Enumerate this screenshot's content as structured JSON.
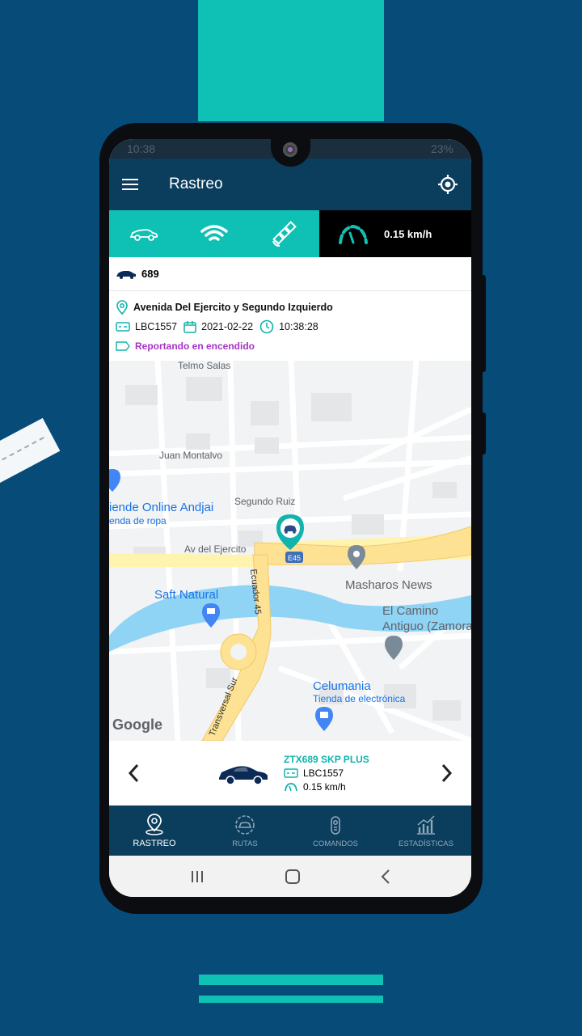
{
  "status_bar": {
    "time": "10:38",
    "battery": "23%"
  },
  "app_bar": {
    "title": "Rastreo",
    "menu_icon": "menu-icon",
    "locate_icon": "gps-target-icon"
  },
  "status_icons": [
    "car-icon",
    "signal-icon",
    "satellite-icon"
  ],
  "speed": {
    "value": "0.15 km/h"
  },
  "vehicle": {
    "name": "689"
  },
  "location": {
    "address": "Avenida Del Ejercito y Segundo Izquierdo",
    "plate": "LBC1557",
    "date": "2021-02-22",
    "time": "10:38:28",
    "status": "Reportando en encendido"
  },
  "map": {
    "labels": {
      "telmo": "Telmo Salas",
      "juan": "Juan Montalvo",
      "segundo": "Segundo Ruiz",
      "ejercito": "Av del Ejercito",
      "ecuador": "Ecuador 45",
      "transversal": "Transversal Sur",
      "tienda_name": "iende Online Andjai",
      "tienda_cat": "enda de ropa",
      "saft": "Saft Natural",
      "masharos": "Masharos News",
      "camino1": "El Camino",
      "camino2": "Antiguo (Zamora",
      "celumania": "Celumania",
      "celumania_cat": "Tienda de electrónica",
      "route": "E45",
      "google": "Google"
    }
  },
  "carousel": {
    "plate_title": "ZTX689  SKP PLUS",
    "plate": "LBC1557",
    "speed": "0.15 km/h"
  },
  "bottom_nav": {
    "tabs": [
      {
        "label": "RASTREO",
        "active": true
      },
      {
        "label": "RUTAS",
        "active": false
      },
      {
        "label": "COMANDOS",
        "active": false
      },
      {
        "label": "ESTADÍSTICAS",
        "active": false
      }
    ]
  },
  "colors": {
    "teal": "#0fc1b4",
    "navy": "#0b3d5d",
    "background": "#074b78",
    "purple": "#a632c6"
  }
}
